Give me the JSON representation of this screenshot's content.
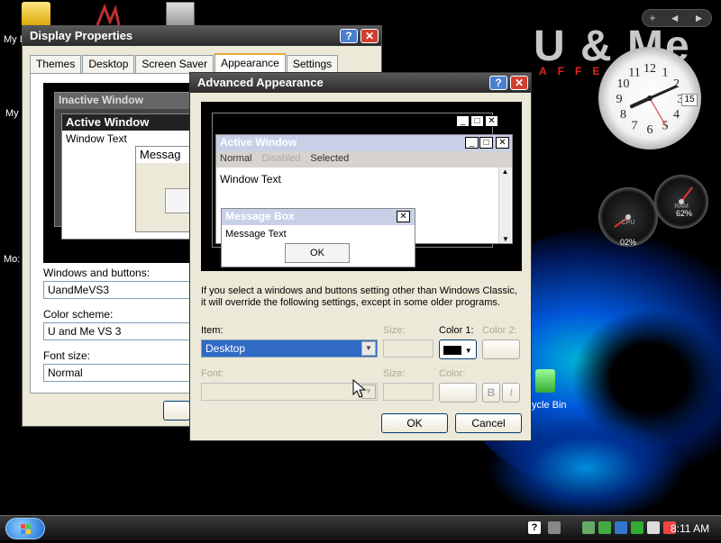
{
  "desktop": {
    "icons": [
      {
        "label": "My I"
      },
      {
        "label": "My"
      },
      {
        "label": "Mo:"
      },
      {
        "label": "ycle Bin"
      }
    ],
    "logo_text": "U & Me",
    "logo_sub": "AFFE",
    "gadget_bar": {
      "add": "+",
      "prev": "◄",
      "next": "►"
    },
    "clock": {
      "date": "15",
      "numerals": [
        "12",
        "1",
        "2",
        "3",
        "4",
        "5",
        "6",
        "7",
        "8",
        "9",
        "10",
        "11"
      ],
      "hour": 8,
      "minute": 11
    },
    "gauges": [
      {
        "label": "CPU",
        "value": "02%"
      },
      {
        "label": "RAM",
        "value": "62%"
      }
    ]
  },
  "display_properties": {
    "title": "Display Properties",
    "tabs": [
      "Themes",
      "Desktop",
      "Screen Saver",
      "Appearance",
      "Settings"
    ],
    "active_tab": "Appearance",
    "preview": {
      "inactive_title": "Inactive Window",
      "active_title": "Active Window",
      "window_text": "Window Text",
      "message_title": "Messag"
    },
    "windows_buttons_label": "Windows and buttons:",
    "windows_buttons_value": "UandMeVS3",
    "color_scheme_label": "Color scheme:",
    "color_scheme_value": "U and Me VS 3",
    "font_size_label": "Font size:",
    "font_size_value": "Normal"
  },
  "advanced": {
    "title": "Advanced Appearance",
    "help": "?",
    "close": "✕",
    "preview": {
      "active_title": "Active Window",
      "menu_normal": "Normal",
      "menu_disabled": "Disabled",
      "menu_selected": "Selected",
      "window_text": "Window Text",
      "message_title": "Message Box",
      "message_text": "Message Text",
      "ok": "OK"
    },
    "info_text": "If you select a windows and buttons setting other than Windows Classic, it will override the following settings, except in some older programs.",
    "item_label": "Item:",
    "item_value": "Desktop",
    "size_label": "Size:",
    "color1_label": "Color 1:",
    "color2_label": "Color 2:",
    "font_label": "Font:",
    "font_size_label": "Size:",
    "font_color_label": "Color:",
    "bold_label": "B",
    "italic_label": "I",
    "ok": "OK",
    "cancel": "Cancel"
  },
  "taskbar": {
    "time": "8:11 AM"
  },
  "colors": {
    "accent_blue": "#316ac5",
    "title_gradient_top": "#5a5a5a",
    "title_gradient_bottom": "#2a2a2a"
  }
}
